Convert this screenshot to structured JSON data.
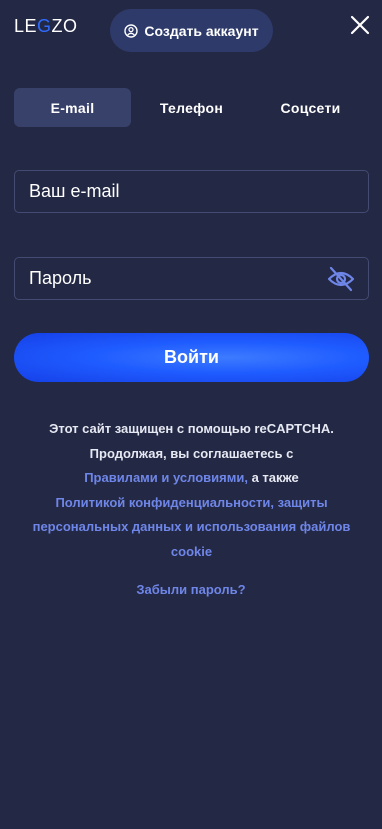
{
  "header": {
    "logo_part1": "LE",
    "logo_accent": "G",
    "logo_part2": "ZO",
    "create_account_label": "Создать аккаунт",
    "create_account_icon": "user-circle-icon",
    "close_icon": "close-icon"
  },
  "tabs": [
    {
      "label": "E-mail",
      "active": true
    },
    {
      "label": "Телефон",
      "active": false
    },
    {
      "label": "Соцсети",
      "active": false
    }
  ],
  "form": {
    "email_placeholder": "Ваш e-mail",
    "email_value": "",
    "password_placeholder": "Пароль",
    "password_value": "",
    "password_toggle_icon": "eye-off-icon",
    "submit_label": "Войти"
  },
  "legal": {
    "line1": "Этот сайт защищен с помощью reCAPTCHA.",
    "line2": "Продолжая, вы соглашаетесь с",
    "terms_link": "Правилами и условиями,",
    "and_also": " а также",
    "privacy_link_1": "Политикой конфиденциальности, защиты",
    "privacy_link_2": "персональных данных и использования файлов",
    "privacy_link_3": "cookie"
  },
  "forgot_password": "Забыли пароль?",
  "colors": {
    "background": "#232844",
    "accent_blue": "#1f5cff",
    "link": "#6f86e9",
    "tab_active": "#38416a",
    "pill_bg": "#2e3a6a"
  }
}
